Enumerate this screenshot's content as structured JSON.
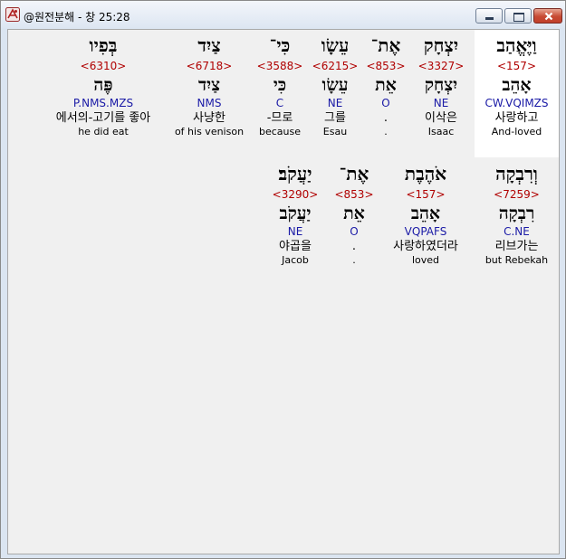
{
  "window": {
    "title": "@원전분해 - 창 25:28",
    "app_icon": "dragon-app-icon"
  },
  "rows": [
    {
      "words": [
        {
          "heb": "וַיֶּאֱהַב",
          "strong": "<157>",
          "lex": "אָהֵב",
          "parse": "CW.VQIMZS",
          "kor": "사랑하고",
          "eng": "And-loved",
          "highlighted": true
        },
        {
          "heb": "יִצְחָק",
          "strong": "<3327>",
          "lex": "יִצְחָק",
          "parse": "NE",
          "kor": "이삭은",
          "eng": "Isaac"
        },
        {
          "heb": "אֶת־",
          "strong": "<853>",
          "lex": "אֵת",
          "parse": "O",
          "kor": ".",
          "eng": "."
        },
        {
          "heb": "עֵשָׂו",
          "strong": "<6215>",
          "lex": "עֵשָׂו",
          "parse": "NE",
          "kor": "그를",
          "eng": "Esau"
        },
        {
          "heb": "כִּי־",
          "strong": "<3588>",
          "lex": "כִּי",
          "parse": "C",
          "kor": "-므로",
          "eng": "because"
        },
        {
          "heb": "צַיִד",
          "strong": "<6718>",
          "lex": "צַיִד",
          "parse": "NMS",
          "kor": "사냥한",
          "eng": "of his venison"
        },
        {
          "heb": "בְּפִיו",
          "strong": "<6310>",
          "lex": "פֶּה",
          "parse": "P.NMS.MZS",
          "kor": "에서의-고기를 좋아",
          "eng": "he did eat"
        }
      ]
    },
    {
      "words": [
        {
          "heb": "וְרִבְקָה",
          "strong": "<7259>",
          "lex": "רִבְקָה",
          "parse": "C.NE",
          "kor": "리브가는",
          "eng": "but Rebekah"
        },
        {
          "heb": "אֹהֶבֶת",
          "strong": "<157>",
          "lex": "אָהֵב",
          "parse": "VQPAFS",
          "kor": "사랑하였더라",
          "eng": "loved"
        },
        {
          "heb": "אֶת־",
          "strong": "<853>",
          "lex": "אֵת",
          "parse": "O",
          "kor": ".",
          "eng": "."
        },
        {
          "heb": "יַעֲקֹב׃",
          "strong": "<3290>",
          "lex": "יַעֲקֹב",
          "parse": "NE",
          "kor": "야곱을",
          "eng": "Jacob"
        }
      ]
    }
  ]
}
